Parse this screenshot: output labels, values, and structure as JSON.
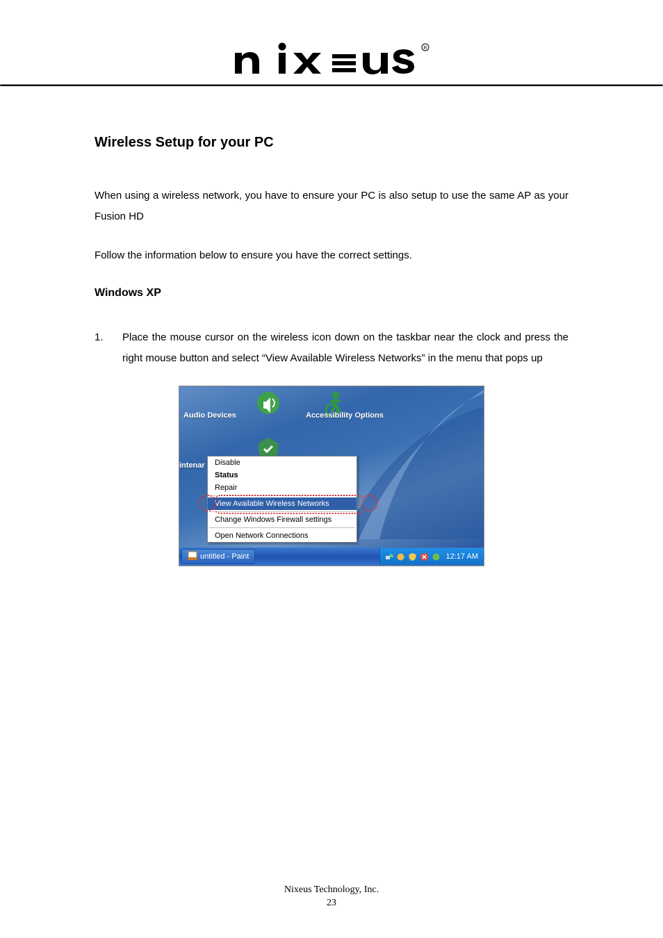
{
  "brand": "nixeus",
  "section_title": "Wireless Setup for your PC",
  "paragraph1": "When using a wireless network, you have to ensure your PC is also setup to use the same AP as your Fusion HD",
  "paragraph2": "Follow the information below to ensure you have the correct settings.",
  "subhead": "Windows XP",
  "step1_num": "1.",
  "step1_text": "Place the mouse cursor on the wireless icon down on the taskbar near the clock and press the right mouse button and select “View Available Wireless Networks” in the menu that pops up",
  "desktop": {
    "audio": "Audio Devices",
    "access": "Accessibility Options",
    "intenar": "intenar"
  },
  "menu": {
    "disable": "Disable",
    "status": "Status",
    "repair": "Repair",
    "view": "View Available Wireless Networks",
    "firewall": "Change Windows Firewall settings",
    "open": "Open Network Connections"
  },
  "taskbar": {
    "app": "untitled - Paint",
    "clock": "12:17 AM"
  },
  "footer": {
    "company": "Nixeus Technology, Inc.",
    "page": "23"
  }
}
